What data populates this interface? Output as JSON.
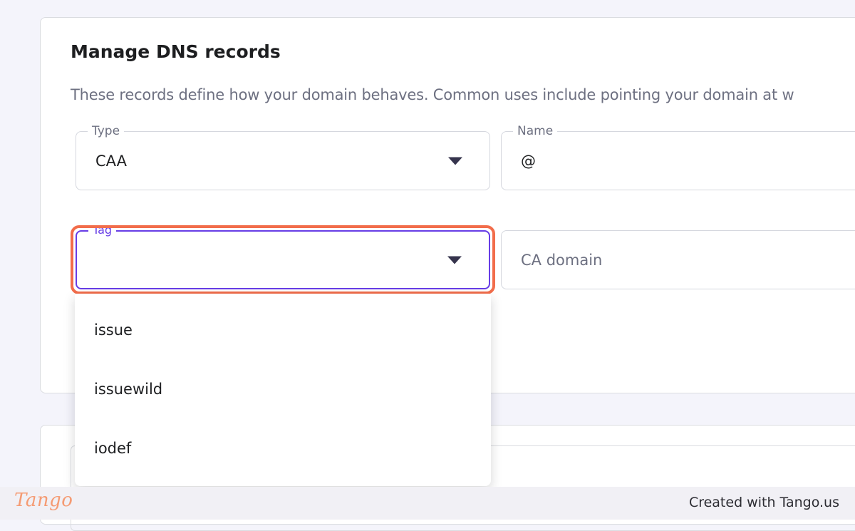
{
  "dns_card": {
    "title": "Manage DNS records",
    "description": "These records define how your domain behaves. Common uses include pointing your domain at w"
  },
  "form": {
    "type": {
      "label": "Type",
      "value": "CAA"
    },
    "name": {
      "label": "Name",
      "value": "@"
    },
    "tag": {
      "label": "Tag",
      "value": ""
    },
    "ca_domain": {
      "placeholder": "CA domain"
    }
  },
  "tag_dropdown": {
    "options": [
      "issue",
      "issuewild",
      "iodef"
    ]
  },
  "colors": {
    "accent": "#673de6",
    "highlight": "#f26d4b"
  },
  "footer": {
    "logo_text": "Tango",
    "credit": "Created with Tango.us"
  }
}
